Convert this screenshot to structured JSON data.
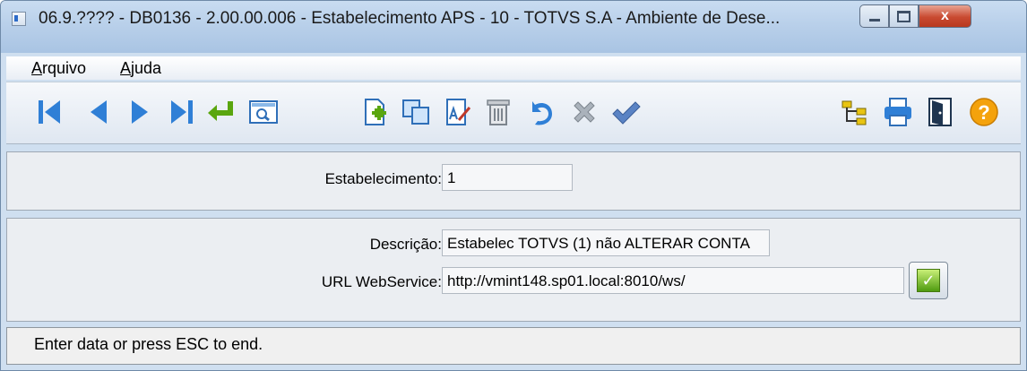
{
  "window": {
    "title": "06.9.???? - DB0136 - 2.00.00.006 - Estabelecimento APS - 10 - TOTVS S.A - Ambiente de Dese...",
    "close_glyph": "x"
  },
  "menu": [
    {
      "key": "A",
      "rest": "rquivo"
    },
    {
      "key": "A",
      "rest": "juda"
    }
  ],
  "toolbar_icons": [
    "first-record-icon",
    "previous-record-icon",
    "next-record-icon",
    "last-record-icon",
    "goto-icon",
    "search-icon",
    "new-record-icon",
    "copy-record-icon",
    "edit-record-icon",
    "delete-record-icon",
    "undo-icon",
    "cancel-icon",
    "save-icon",
    "tree-icon",
    "print-icon",
    "exit-icon",
    "help-icon"
  ],
  "form": {
    "estabelecimento_label": "Estabelecimento:",
    "estabelecimento_value": "1",
    "descricao_label": "Descrição:",
    "descricao_value": "Estabelec TOTVS (1) não ALTERAR CONTA",
    "url_label": "URL WebService:",
    "url_value": "http://vmint148.sp01.local:8010/ws/"
  },
  "status": {
    "text": "Enter data or press ESC to end."
  },
  "colors": {
    "nav_blue": "#2f7fd6",
    "goto_green": "#5aa60f",
    "ok_green": "#4f9b10",
    "close_red": "#c94a31",
    "help_orange": "#f4a20c"
  }
}
